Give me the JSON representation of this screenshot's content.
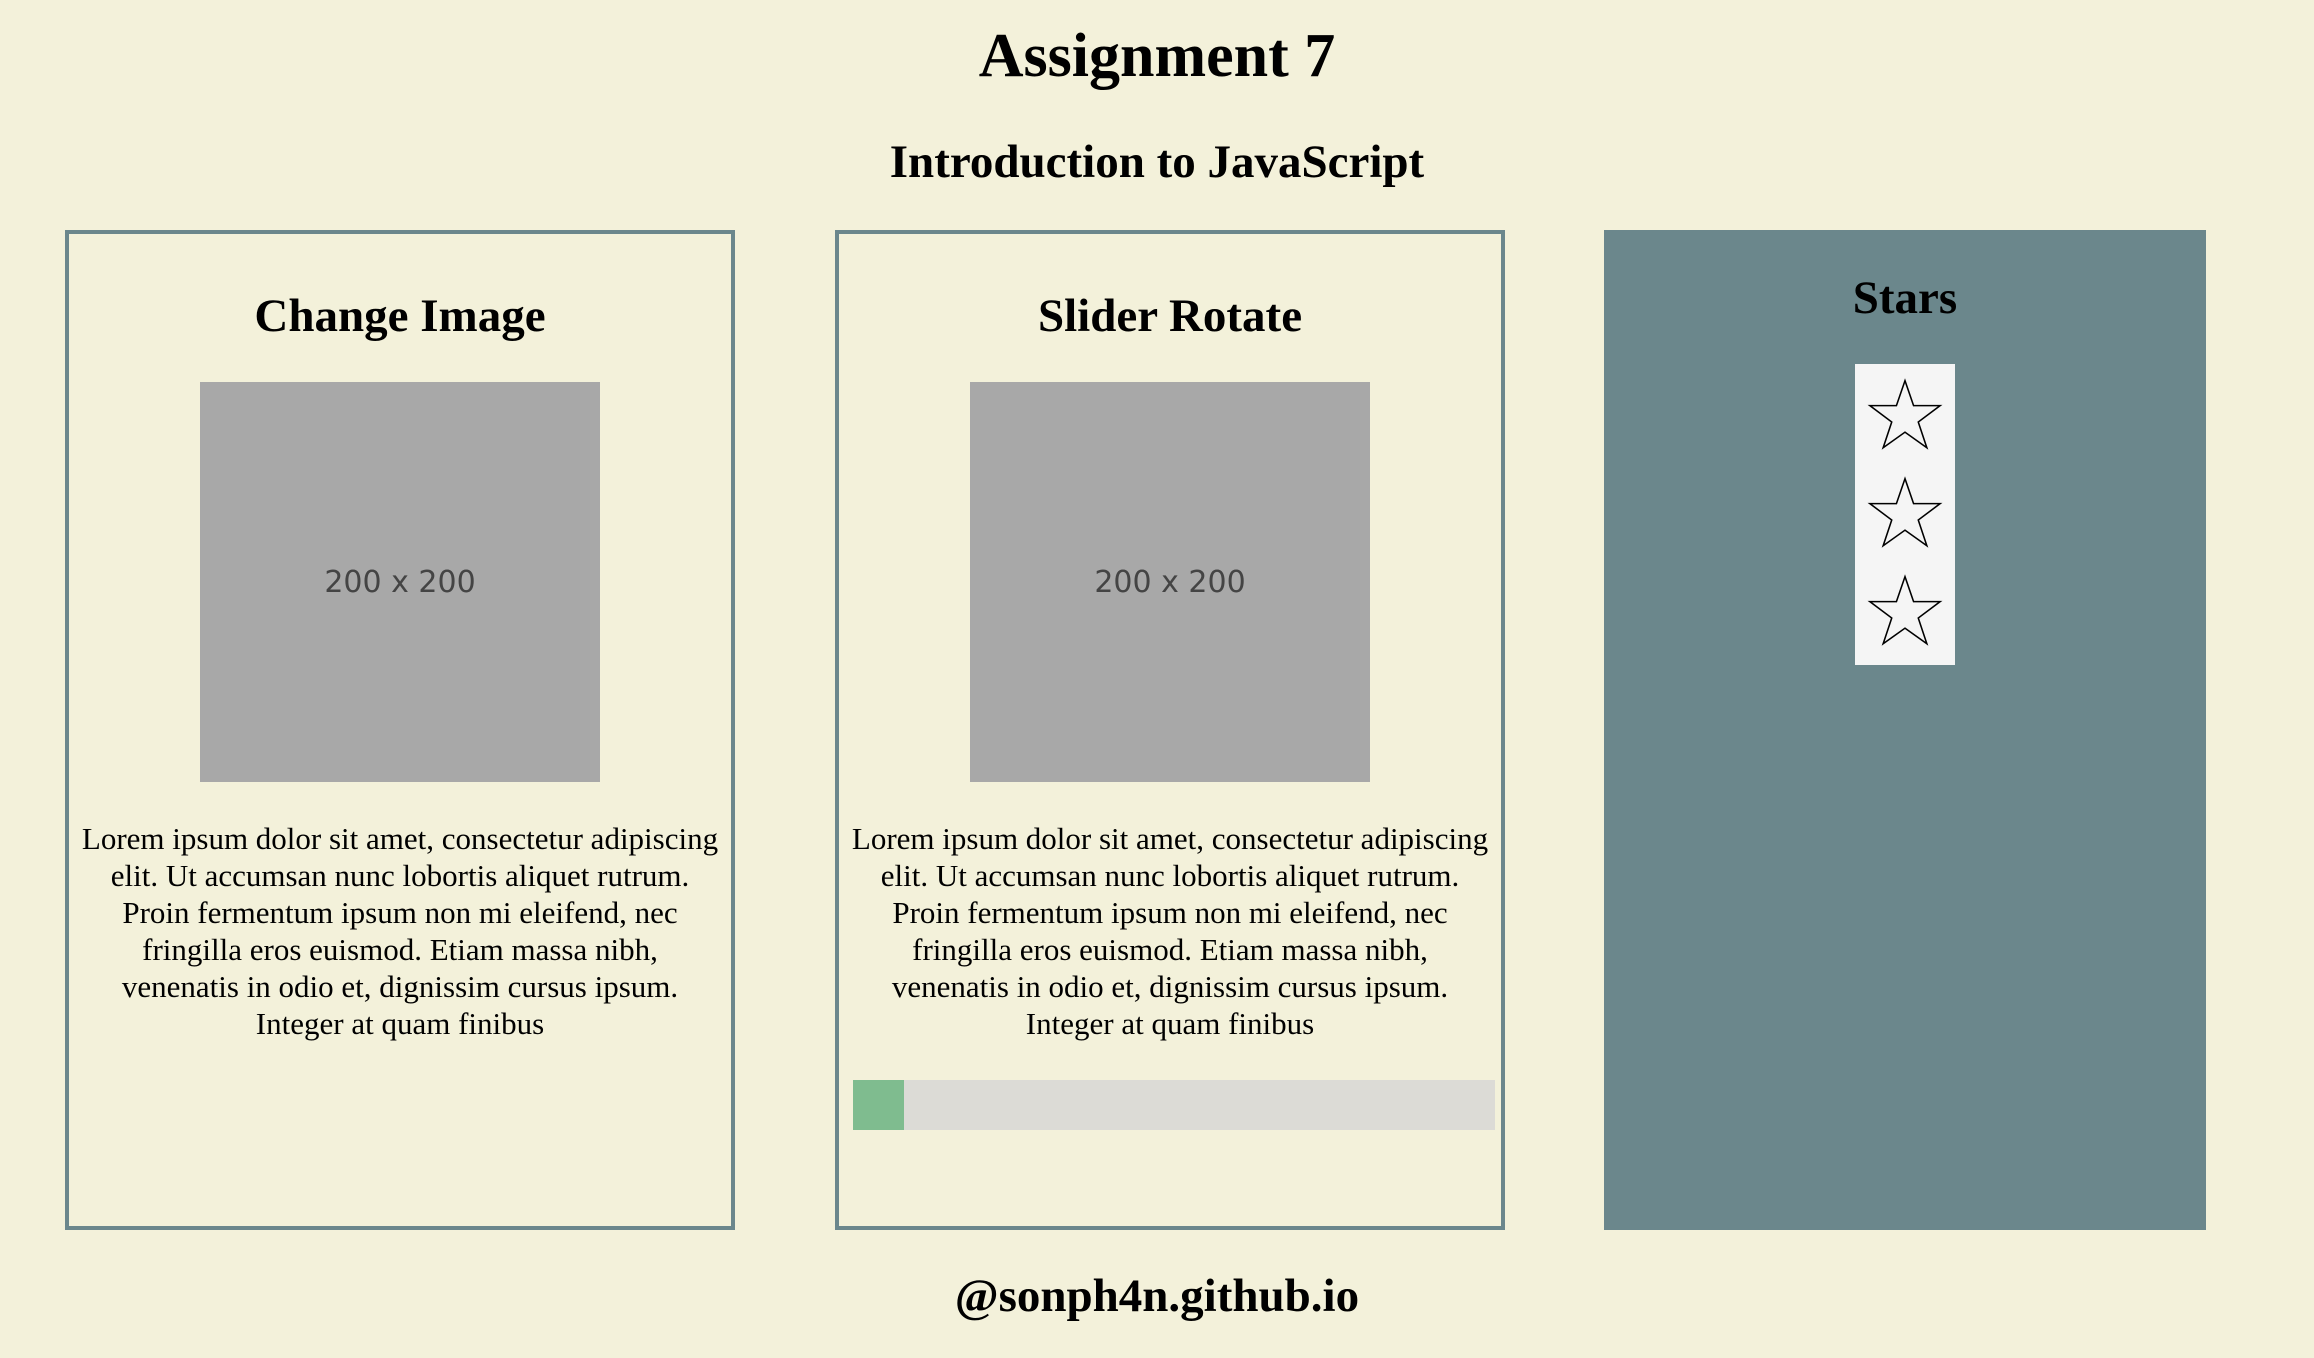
{
  "header": {
    "title": "Assignment 7",
    "subtitle": "Introduction to JavaScript"
  },
  "cards": [
    {
      "title": "Change Image",
      "image_label": "200 x 200",
      "text": "Lorem ipsum dolor sit amet, consectetur adipiscing elit. Ut accumsan nunc lobortis aliquet rutrum. Proin fermentum ipsum non mi eleifend, nec fringilla eros euismod. Etiam massa nibh, venenatis in odio et, dignissim cursus ipsum. Integer at quam finibus"
    },
    {
      "title": "Slider Rotate",
      "image_label": "200 x 200",
      "text": "Lorem ipsum dolor sit amet, consectetur adipiscing elit. Ut accumsan nunc lobortis aliquet rutrum. Proin fermentum ipsum non mi eleifend, nec fringilla eros euismod. Etiam massa nibh, venenatis in odio et, dignissim cursus ipsum. Integer at quam finibus",
      "progress_percent": 8
    },
    {
      "title": "Stars",
      "stars": [
        "star-outline-icon",
        "star-outline-icon",
        "star-outline-icon"
      ]
    }
  ],
  "footer": {
    "text": "@sonph4n.github.io"
  },
  "colors": {
    "background": "#f3f1da",
    "card_border": "#6b878c",
    "stars_card_bg": "#6b878c",
    "placeholder_bg": "#a8a8a8",
    "progress_track": "#dcdbd6",
    "progress_fill": "#7fbc8f"
  }
}
